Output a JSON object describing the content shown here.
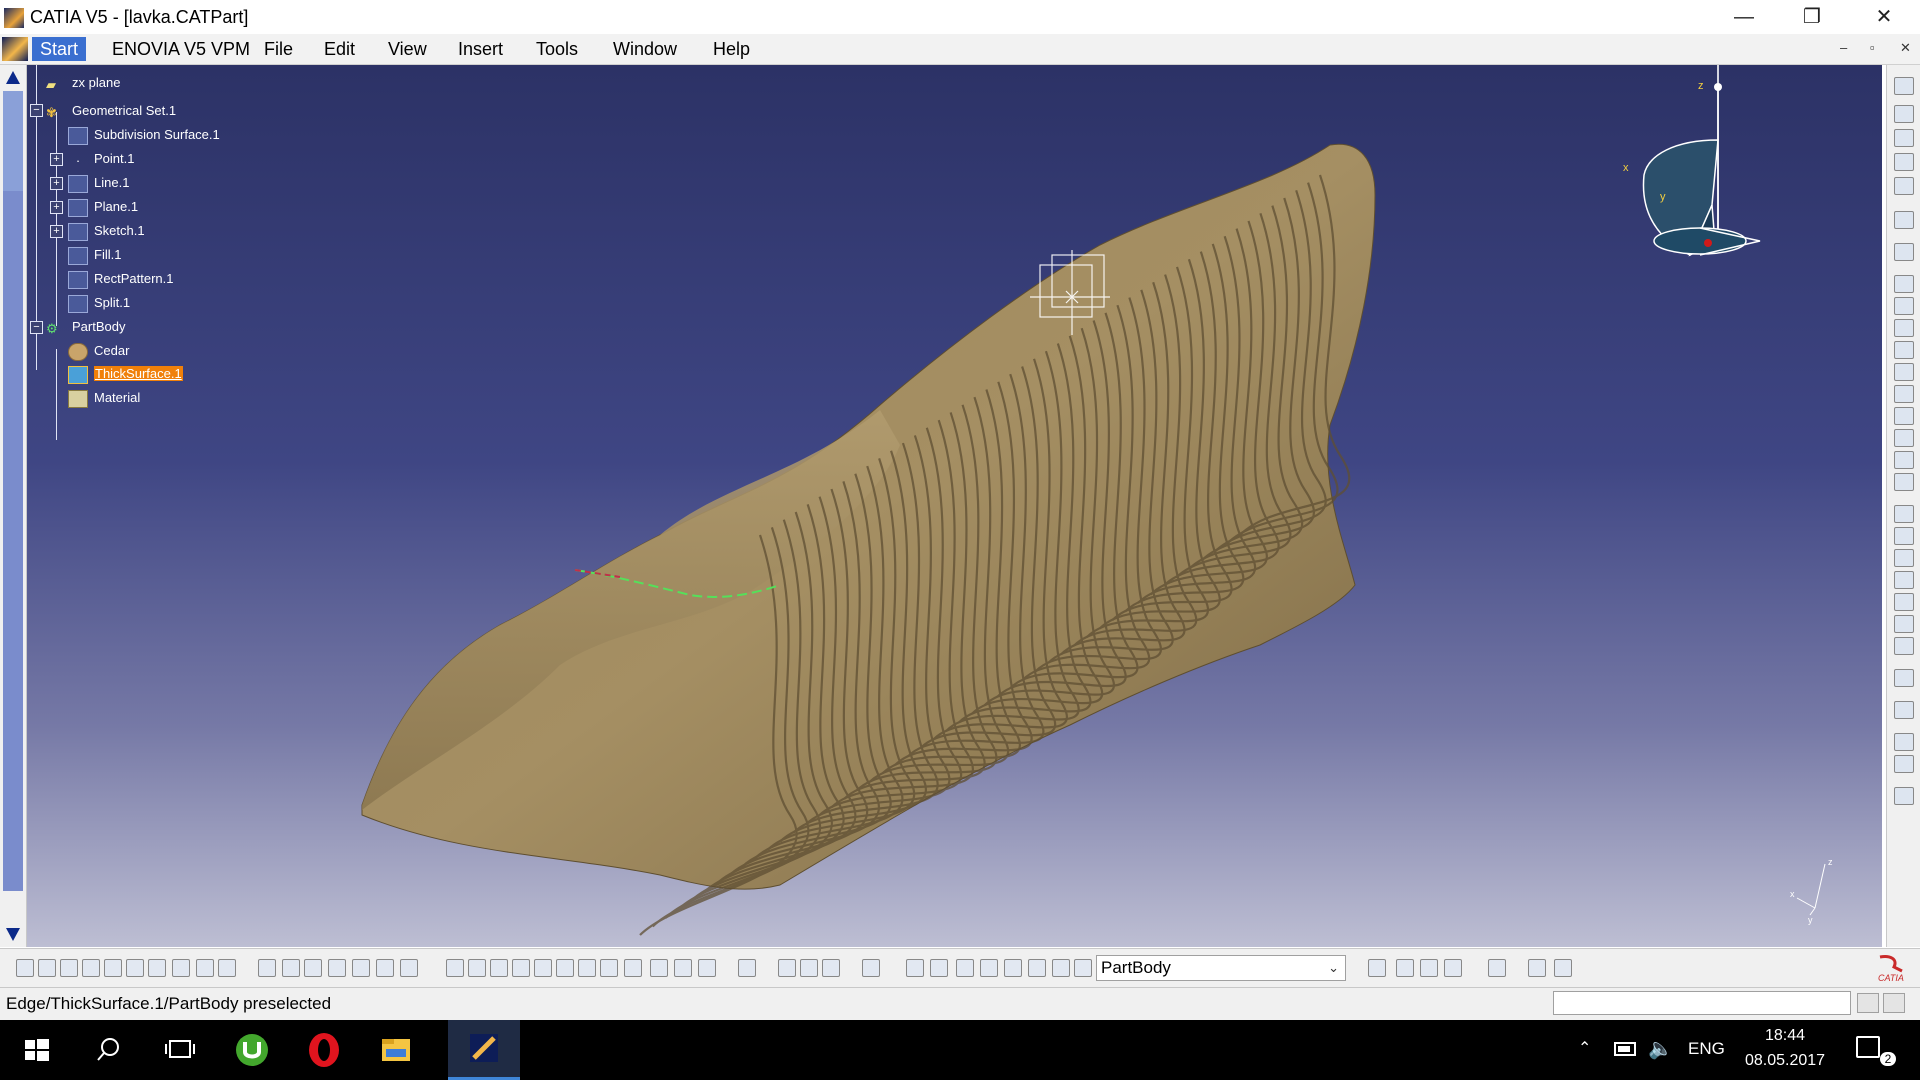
{
  "window": {
    "title": "CATIA V5 - [lavka.CATPart]",
    "buttons": [
      "minimize",
      "restore",
      "close"
    ]
  },
  "menubar": {
    "items": [
      "Start",
      "ENOVIA V5 VPM",
      "File",
      "Edit",
      "View",
      "Insert",
      "Tools",
      "Window",
      "Help"
    ]
  },
  "tree": {
    "nodes": [
      {
        "label": "zx plane"
      },
      {
        "label": "Geometrical Set.1"
      },
      {
        "label": "Subdivision Surface.1"
      },
      {
        "label": "Point.1"
      },
      {
        "label": "Line.1"
      },
      {
        "label": "Plane.1"
      },
      {
        "label": "Sketch.1"
      },
      {
        "label": "Fill.1"
      },
      {
        "label": "RectPattern.1"
      },
      {
        "label": "Split.1"
      },
      {
        "label": "PartBody"
      },
      {
        "label": "Cedar"
      },
      {
        "label": "ThickSurface.1",
        "selected": true
      },
      {
        "label": "Material"
      }
    ]
  },
  "compass": {
    "x_label": "x",
    "y_label": "y",
    "z_label": "z"
  },
  "axis_mini": {
    "x_label": "x",
    "y_label": "y",
    "z_label": "z"
  },
  "toolbar": {
    "current_body": "PartBody"
  },
  "status": {
    "message": "Edge/ThickSurface.1/PartBody preselected"
  },
  "taskbar": {
    "language": "ENG",
    "time": "18:44",
    "date": "08.05.2017",
    "notification_count": "2"
  },
  "catia_logo_text": "CATIA",
  "colors": {
    "background_top": "#2c3266",
    "background_bottom": "#bdbed3",
    "model_wood": "#a08a5e",
    "selection": "#f0800a"
  }
}
